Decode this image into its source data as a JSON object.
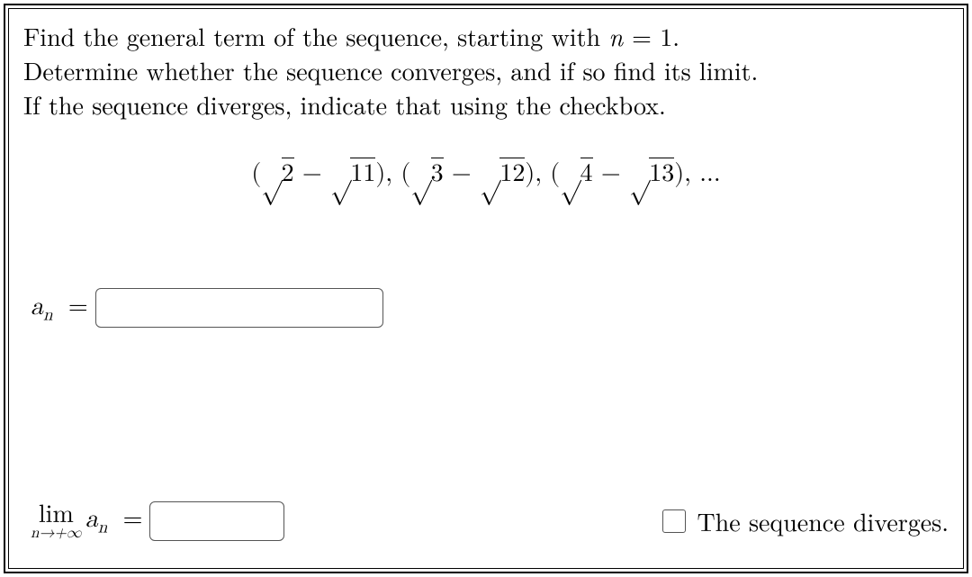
{
  "problem": {
    "line1": "Find the general term of the sequence, starting with ",
    "line1_math": "n = 1.",
    "line2": "Determine whether the sequence converges, and if so find its limit.",
    "line3": "If the sequence diverges, indicate that using the checkbox."
  },
  "sequence_terms": [
    {
      "a": "2",
      "b": "11"
    },
    {
      "a": "3",
      "b": "12"
    },
    {
      "a": "4",
      "b": "13"
    }
  ],
  "labels": {
    "an": "a",
    "an_sub": "n",
    "equals": " = ",
    "lim": "lim",
    "lim_sub": "n→+∞",
    "diverges": "The sequence diverges."
  },
  "inputs": {
    "general_term": "",
    "limit_value": "",
    "diverges_checked": false
  }
}
